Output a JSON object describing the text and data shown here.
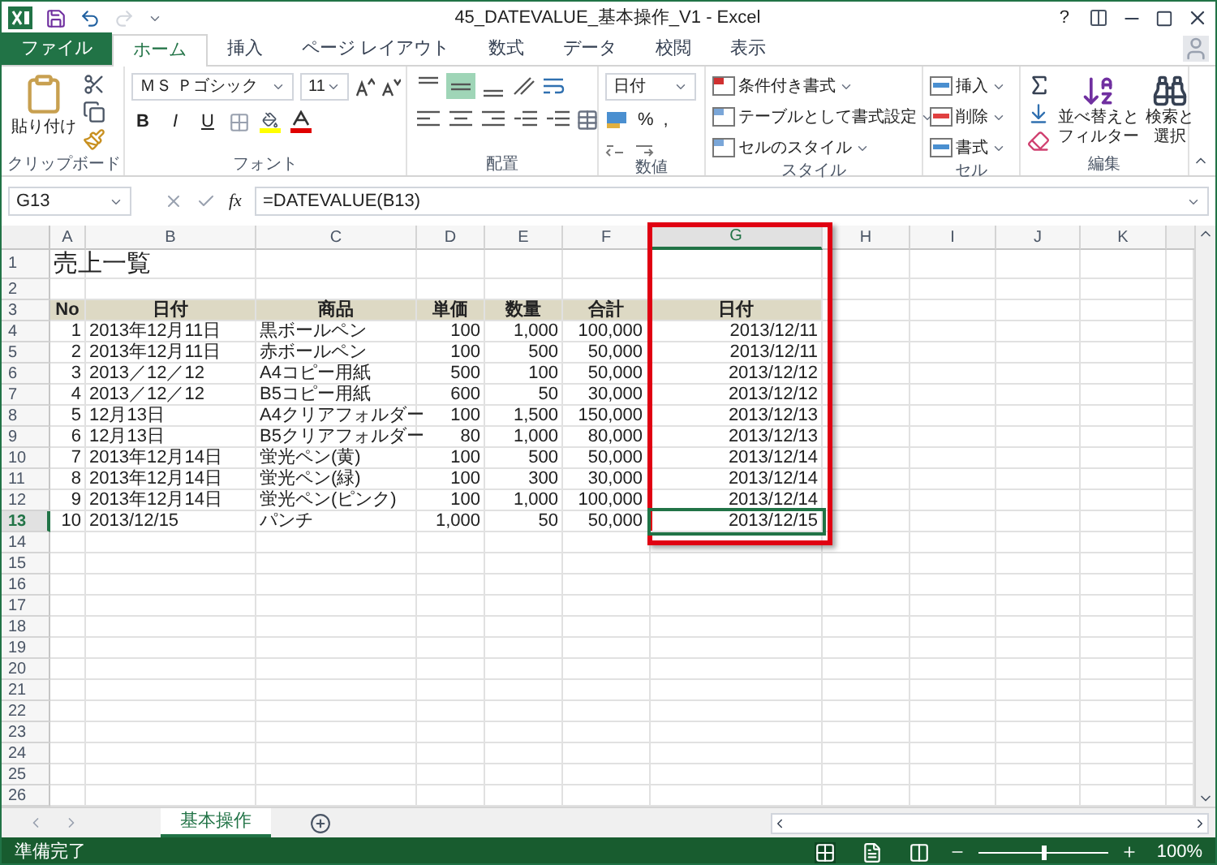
{
  "window": {
    "title": "45_DATEVALUE_基本操作_V1 - Excel",
    "help": "?"
  },
  "tabs": [
    {
      "label": "ファイル",
      "kind": "file",
      "selected": false
    },
    {
      "label": "ホーム",
      "kind": "tab",
      "selected": true
    },
    {
      "label": "挿入",
      "kind": "tab",
      "selected": false
    },
    {
      "label": "ページ レイアウト",
      "kind": "tab",
      "selected": false
    },
    {
      "label": "数式",
      "kind": "tab",
      "selected": false
    },
    {
      "label": "データ",
      "kind": "tab",
      "selected": false
    },
    {
      "label": "校閲",
      "kind": "tab",
      "selected": false
    },
    {
      "label": "表示",
      "kind": "tab",
      "selected": false
    }
  ],
  "ribbon": {
    "groups": [
      {
        "kind": "clipboard",
        "label": "クリップボード",
        "paste": "貼り付け"
      },
      {
        "kind": "font",
        "label": "フォント",
        "font_name": "ＭＳ Ｐゴシック",
        "font_size": "11",
        "styles": [
          "B",
          "I",
          "U"
        ]
      },
      {
        "kind": "alignment",
        "label": "配置",
        "valign": [
          {
            "selected": false
          },
          {
            "selected": true
          },
          {
            "selected": false
          }
        ]
      },
      {
        "kind": "number",
        "label": "数値",
        "format": "日付",
        "symbols": [
          "%",
          ","
        ]
      },
      {
        "kind": "styles",
        "label": "スタイル",
        "buttons": [
          "条件付き書式",
          "テーブルとして書式設定",
          "セルのスタイル"
        ]
      },
      {
        "kind": "cells",
        "label": "セル",
        "buttons": [
          "挿入",
          "削除",
          "書式"
        ]
      },
      {
        "kind": "editing",
        "label": "編集",
        "buttons": [
          [
            "並べ替えと",
            "フィルター"
          ],
          [
            "検索と",
            "選択"
          ]
        ]
      }
    ]
  },
  "formula_bar": {
    "name_box": "G13",
    "fx": "fx",
    "formula": "=DATEVALUE(B13)"
  },
  "columns": [
    {
      "letter": "A",
      "selected": false
    },
    {
      "letter": "B",
      "selected": false
    },
    {
      "letter": "C",
      "selected": false
    },
    {
      "letter": "D",
      "selected": false
    },
    {
      "letter": "E",
      "selected": false
    },
    {
      "letter": "F",
      "selected": false
    },
    {
      "letter": "G",
      "selected": true
    },
    {
      "letter": "H",
      "selected": false
    },
    {
      "letter": "I",
      "selected": false
    },
    {
      "letter": "J",
      "selected": false
    },
    {
      "letter": "K",
      "selected": false
    }
  ],
  "rows": [
    {
      "number": "1",
      "kind": "title",
      "text": "売上一覧",
      "selected": false
    },
    {
      "number": "2",
      "kind": "blank",
      "selected": false
    },
    {
      "number": "3",
      "kind": "header",
      "values": [
        "No",
        "日付",
        "商品",
        "単価",
        "数量",
        "合計"
      ],
      "column_g": "日付",
      "selected": false
    },
    {
      "number": "4",
      "kind": "data",
      "values": [
        "1",
        "2013年12月11日",
        "黒ボールペン",
        "100",
        "1,000",
        "100,000"
      ],
      "column_g": "2013/12/11",
      "selected": false
    },
    {
      "number": "5",
      "kind": "data",
      "values": [
        "2",
        "2013年12月11日",
        "赤ボールペン",
        "100",
        "500",
        "50,000"
      ],
      "column_g": "2013/12/11",
      "selected": false
    },
    {
      "number": "6",
      "kind": "data",
      "values": [
        "3",
        "2013／12／12",
        "A4コピー用紙",
        "500",
        "100",
        "50,000"
      ],
      "column_g": "2013/12/12",
      "selected": false
    },
    {
      "number": "7",
      "kind": "data",
      "values": [
        "4",
        "2013／12／12",
        "B5コピー用紙",
        "600",
        "50",
        "30,000"
      ],
      "column_g": "2013/12/12",
      "selected": false
    },
    {
      "number": "8",
      "kind": "data",
      "values": [
        "5",
        "12月13日",
        "A4クリアフォルダー",
        "100",
        "1,500",
        "150,000"
      ],
      "column_g": "2013/12/13",
      "selected": false
    },
    {
      "number": "9",
      "kind": "data",
      "values": [
        "6",
        "12月13日",
        "B5クリアフォルダー",
        "80",
        "1,000",
        "80,000"
      ],
      "column_g": "2013/12/13",
      "selected": false
    },
    {
      "number": "10",
      "kind": "data",
      "values": [
        "7",
        "2013年12月14日",
        "蛍光ペン(黄)",
        "100",
        "500",
        "50,000"
      ],
      "column_g": "2013/12/14",
      "selected": false
    },
    {
      "number": "11",
      "kind": "data",
      "values": [
        "8",
        "2013年12月14日",
        "蛍光ペン(緑)",
        "100",
        "300",
        "30,000"
      ],
      "column_g": "2013/12/14",
      "selected": false
    },
    {
      "number": "12",
      "kind": "data",
      "values": [
        "9",
        "2013年12月14日",
        "蛍光ペン(ピンク)",
        "100",
        "1,000",
        "100,000"
      ],
      "column_g": "2013/12/14",
      "selected": false
    },
    {
      "number": "13",
      "kind": "data",
      "values": [
        "10",
        "2013/12/15",
        "パンチ",
        "1,000",
        "50",
        "50,000"
      ],
      "column_g": "2013/12/15",
      "selected": true
    },
    {
      "number": "14",
      "kind": "blank",
      "selected": false
    },
    {
      "number": "15",
      "kind": "blank",
      "selected": false
    },
    {
      "number": "16",
      "kind": "blank",
      "selected": false
    },
    {
      "number": "17",
      "kind": "blank",
      "selected": false
    },
    {
      "number": "18",
      "kind": "blank",
      "selected": false
    },
    {
      "number": "19",
      "kind": "blank",
      "selected": false
    },
    {
      "number": "20",
      "kind": "blank",
      "selected": false
    },
    {
      "number": "21",
      "kind": "blank",
      "selected": false
    },
    {
      "number": "22",
      "kind": "blank",
      "selected": false
    },
    {
      "number": "23",
      "kind": "blank",
      "selected": false
    },
    {
      "number": "24",
      "kind": "blank",
      "selected": false
    },
    {
      "number": "25",
      "kind": "blank",
      "selected": false
    },
    {
      "number": "26",
      "kind": "blank",
      "selected": false
    }
  ],
  "sheet_tabs": [
    {
      "label": "基本操作",
      "selected": true
    }
  ],
  "status_bar": {
    "text": "準備完了",
    "views": [
      {
        "selected": true
      },
      {
        "selected": false
      },
      {
        "selected": false
      }
    ],
    "zoom": {
      "level": 0.5
    },
    "zoom_text": "100%"
  }
}
